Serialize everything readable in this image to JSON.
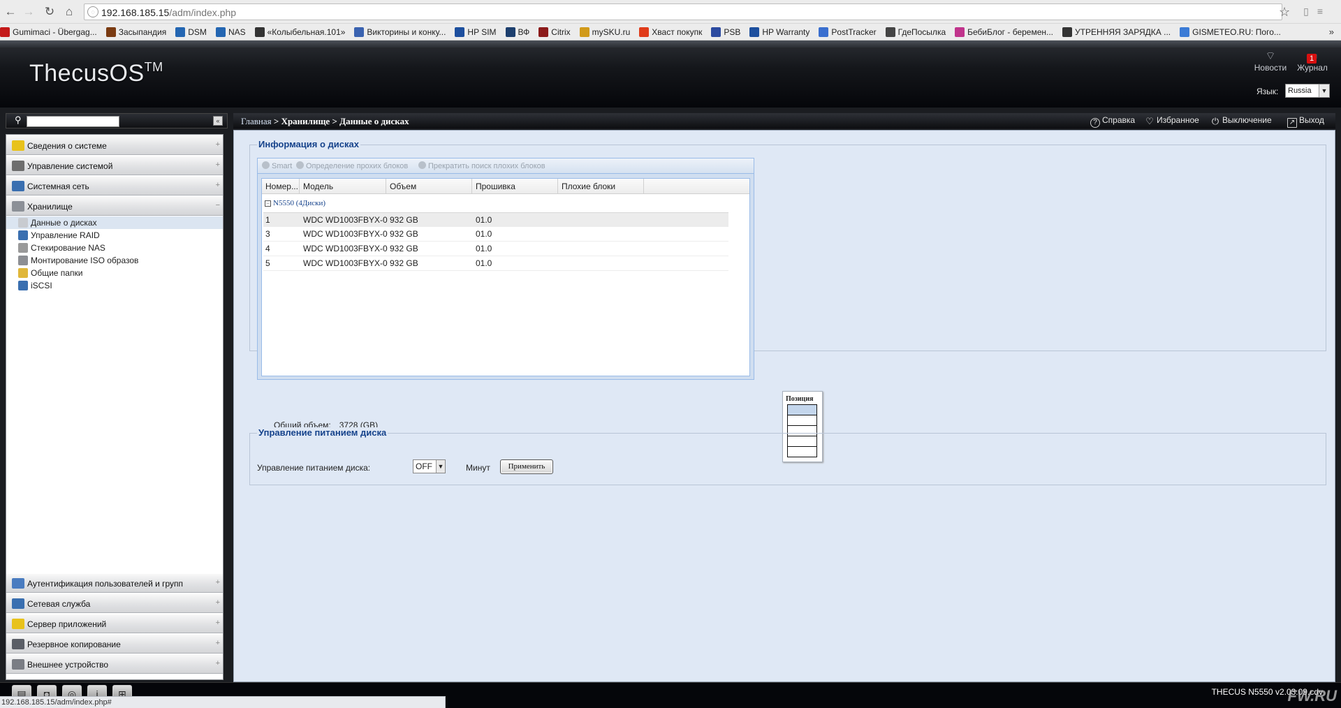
{
  "browser": {
    "url_host": "192.168.185.15",
    "url_path": "/adm/index.php",
    "bookmarks": [
      {
        "label": "Gumimaci - Übergag...",
        "color": "#c41a1a"
      },
      {
        "label": "Засыпандия",
        "color": "#7a3b12"
      },
      {
        "label": "DSM",
        "color": "#2466b2"
      },
      {
        "label": "NAS",
        "color": "#2466b2"
      },
      {
        "label": "«Колыбельная.101»",
        "color": "#333333"
      },
      {
        "label": "Викторины и конку...",
        "color": "#3a62b0"
      },
      {
        "label": "HP SIM",
        "color": "#1d4f9e"
      },
      {
        "label": "ВФ",
        "color": "#1d3f6e"
      },
      {
        "label": "Citrix",
        "color": "#8b1a1a"
      },
      {
        "label": "mySKU.ru",
        "color": "#d19a1a"
      },
      {
        "label": "Хваст покупк",
        "color": "#e03b1a"
      },
      {
        "label": "PSB",
        "color": "#2b4aa0"
      },
      {
        "label": "HP Warranty",
        "color": "#1d4f9e"
      },
      {
        "label": "PostTracker",
        "color": "#3a6fcf"
      },
      {
        "label": "ГдеПосылка",
        "color": "#444444"
      },
      {
        "label": "БебиБлог - беремен...",
        "color": "#c0348c"
      },
      {
        "label": "УТРЕННЯЯ ЗАРЯДКА ...",
        "color": "#333333"
      },
      {
        "label": "GISMETEO.RU: Пого...",
        "color": "#3b7bd6"
      }
    ],
    "more": "»",
    "status_url": "192.168.185.15/adm/index.php#"
  },
  "header": {
    "logo": "ThecusOS",
    "logo_tm": "TM",
    "news_label": "Новости",
    "journal_label": "Журнал",
    "journal_badge": "1",
    "lang_label": "Язык:",
    "lang_value": "Russia"
  },
  "sidebar": {
    "search_placeholder": "",
    "top_categories": [
      {
        "label": "Сведения о системе",
        "toggle": "+",
        "color": "#e8c21c"
      },
      {
        "label": "Управление системой",
        "toggle": "+",
        "color": "#6e6e6e"
      },
      {
        "label": "Системная сеть",
        "toggle": "+",
        "color": "#3a6fb0"
      },
      {
        "label": "Хранилище",
        "toggle": "−",
        "color": "#8c9097"
      }
    ],
    "storage_items": [
      {
        "label": "Данные о дисках",
        "color": "#c8cbd0",
        "active": true
      },
      {
        "label": "Управление RAID",
        "color": "#3a6fb0"
      },
      {
        "label": "Стекирование NAS",
        "color": "#9a9a9a"
      },
      {
        "label": "Монтирование ISO образов",
        "color": "#8d8f94"
      },
      {
        "label": "Общие папки",
        "color": "#e0b73a"
      },
      {
        "label": "iSCSI",
        "color": "#3a6fb0"
      }
    ],
    "bottom_categories": [
      {
        "label": "Аутентификация пользователей и групп",
        "toggle": "+",
        "color": "#4a7cc0"
      },
      {
        "label": "Сетевая служба",
        "toggle": "+",
        "color": "#3a6fb0"
      },
      {
        "label": "Сервер приложений",
        "toggle": "+",
        "color": "#e8c21c"
      },
      {
        "label": "Резервное копирование",
        "toggle": "+",
        "color": "#5a5e66"
      },
      {
        "label": "Внешнее устройство",
        "toggle": "+",
        "color": "#7a7d84"
      }
    ]
  },
  "content": {
    "breadcrumb_home": "Главная",
    "breadcrumb_sep1": ">",
    "breadcrumb_section": "Хранилище",
    "breadcrumb_sep2": ">",
    "breadcrumb_page": "Данные о дисках",
    "top_actions": {
      "help": "Справка",
      "favorites": "Избранное",
      "shutdown": "Выключение",
      "logout": "Выход"
    },
    "disk_panel": {
      "title": "Информация о дисках",
      "toolbar": {
        "smart": "Smart",
        "detect": "Определение прохих блоков",
        "stop": "Прекратить поиск плохих блоков"
      },
      "columns": [
        "Номер...",
        "Модель",
        "Объем",
        "Прошивка",
        "Плохие блоки"
      ],
      "group_label": "N5550 (4Диски)",
      "rows": [
        {
          "num": "1",
          "model": "WDC WD1003FBYX-0",
          "size": "932 GB",
          "firmware": "01.0",
          "bad": ""
        },
        {
          "num": "3",
          "model": "WDC WD1003FBYX-0",
          "size": "932 GB",
          "firmware": "01.0",
          "bad": ""
        },
        {
          "num": "4",
          "model": "WDC WD1003FBYX-0",
          "size": "932 GB",
          "firmware": "01.0",
          "bad": ""
        },
        {
          "num": "5",
          "model": "WDC WD1003FBYX-0",
          "size": "932 GB",
          "firmware": "01.0",
          "bad": ""
        }
      ],
      "popup_title": "Позиция",
      "total_label": "Общий объем:",
      "total_value": "3728 (GB)"
    },
    "power_panel": {
      "title": "Управление питанием диска",
      "label": "Управление питанием диска:",
      "value": "OFF",
      "unit": "Минут",
      "apply": "Применить"
    }
  },
  "taskbar": {
    "version": "THECUS N5550 v2.03.09.cdv",
    "watermark": "FW.RU"
  }
}
